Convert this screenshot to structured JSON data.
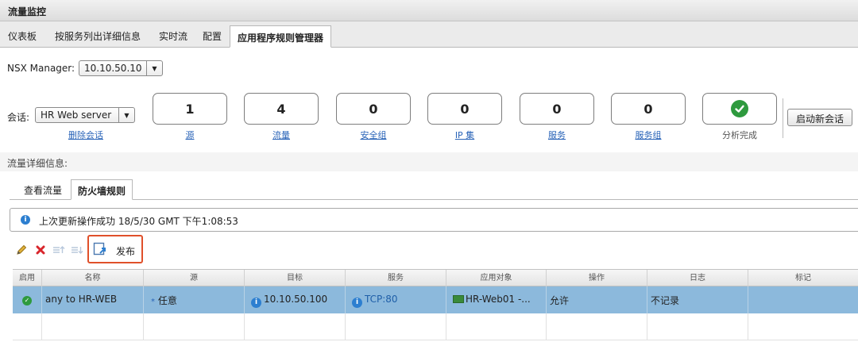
{
  "window": {
    "title": "流量监控"
  },
  "tabs": [
    {
      "label": "仪表板"
    },
    {
      "label": "按服务列出详细信息"
    },
    {
      "label": "实时流"
    },
    {
      "label": "配置"
    },
    {
      "label": "应用程序规则管理器",
      "active": true
    }
  ],
  "manager": {
    "label": "NSX Manager:",
    "value": "10.10.50.10"
  },
  "session": {
    "label": "会话:",
    "value": "HR Web server",
    "delete_link": "删除会话"
  },
  "stats": [
    {
      "value": "1",
      "label": "源"
    },
    {
      "value": "4",
      "label": "流量"
    },
    {
      "value": "0",
      "label": "安全组"
    },
    {
      "value": "0",
      "label": "IP 集"
    },
    {
      "value": "0",
      "label": "服务"
    },
    {
      "value": "0",
      "label": "服务组"
    }
  ],
  "analysis": {
    "label": "分析完成",
    "status_icon": "green-check-icon"
  },
  "start_session_button": "启动新会话",
  "details": {
    "label": "流量详细信息:"
  },
  "subtabs": [
    {
      "label": "查看流量"
    },
    {
      "label": "防火墙规则",
      "active": true
    }
  ],
  "info": {
    "text": "上次更新操作成功 18/5/30 GMT 下午1:08:53"
  },
  "toolbar": {
    "publish_label": "发布",
    "icons": [
      "edit-pencil-icon",
      "delete-x-icon",
      "move-up-icon",
      "move-down-icon",
      "publish-icon"
    ]
  },
  "table": {
    "columns": [
      "启用",
      "名称",
      "源",
      "目标",
      "服务",
      "应用对象",
      "操作",
      "日志",
      "标记"
    ],
    "rows": [
      {
        "enabled": true,
        "name": "any to HR-WEB",
        "source": "任意",
        "source_prefix": "*",
        "target": "10.10.50.100",
        "service": "TCP:80",
        "app_object": "HR-Web01 -...",
        "action": "允许",
        "log": "不记录",
        "tag": ""
      }
    ]
  },
  "colors": {
    "accent_blue": "#2d7fd0",
    "selected_row": "#8cb9dc",
    "success_green": "#2e9a3e",
    "highlight_red": "#e0502a",
    "link": "#2a64b8"
  }
}
